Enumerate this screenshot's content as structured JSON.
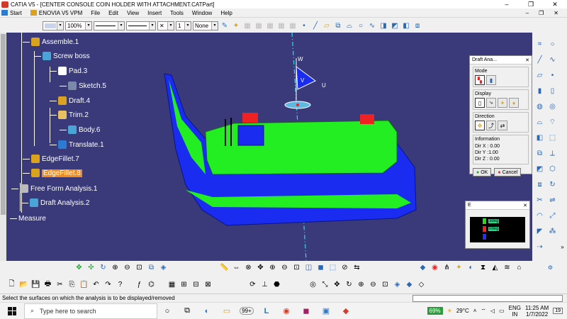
{
  "window": {
    "title": "CATIA V5 - [CENTER CONSOLE COIN HOLDER WITH ATTACHMENT.CATPart]",
    "minimize": "–",
    "restore": "❐",
    "close": "✕"
  },
  "menu": {
    "start": "Start",
    "enovia": "ENOVIA V5 VPM",
    "items": [
      "File",
      "Edit",
      "View",
      "Insert",
      "Tools",
      "Window",
      "Help"
    ],
    "doc_minimize": "–",
    "doc_restore": "❐",
    "doc_close": "✕"
  },
  "toolbar": {
    "zoom_value": "100%",
    "layer_value": "None",
    "point_value": "1"
  },
  "tree": {
    "items": [
      {
        "label": "Assemble.1",
        "icon": "assemble-icon"
      },
      {
        "label": "Screw boss",
        "icon": "body-icon"
      },
      {
        "label": "Pad.3",
        "icon": "pad-icon"
      },
      {
        "label": "Sketch.5",
        "icon": "sketch-icon"
      },
      {
        "label": "Draft.4",
        "icon": "draft-icon"
      },
      {
        "label": "Trim.2",
        "icon": "trim-icon"
      },
      {
        "label": "Body.6",
        "icon": "body-icon"
      },
      {
        "label": "Translate.1",
        "icon": "translate-icon"
      },
      {
        "label": "EdgeFillet.7",
        "icon": "fillet-icon"
      },
      {
        "label": "EdgeFillet.8",
        "icon": "fillet-icon"
      },
      {
        "label": "Free Form Analysis.1",
        "icon": "analysis-set-icon"
      },
      {
        "label": "Draft Analysis.2",
        "icon": "draft-analysis-icon"
      },
      {
        "label": "Measure",
        "icon": "measure-icon"
      }
    ]
  },
  "compass": {
    "w": "W",
    "v": "V",
    "u": "U"
  },
  "draft_dialog": {
    "title": "Draft Ana...",
    "close": "✕",
    "mode_label": "Mode",
    "display_label": "Display",
    "direction_label": "Direction",
    "information_label": "Information",
    "dir_x": "Dir X : 0.00",
    "dir_y": "Dir Y :1.00",
    "dir_z": "Dir Z : 0.00",
    "ok": "OK",
    "cancel": "Cancel"
  },
  "legend_window": {
    "title": "E",
    "close": "✕",
    "entries": [
      {
        "color": "#22dd22",
        "label": "3deg"
      },
      {
        "color": "#ee2222",
        "label": "0deg"
      },
      {
        "color": "#2233ee",
        "label": ""
      }
    ]
  },
  "status": {
    "message": "Select the surfaces on which the analysis is to be displayed/removed"
  },
  "taskbar": {
    "search_placeholder": "Type here to search",
    "badge": "99+",
    "battery": "69%",
    "temperature": "29°C",
    "lang1": "ENG",
    "lang2": "IN",
    "time": "11:25 AM",
    "date": "1/7/2022",
    "notifications": "19"
  },
  "colors": {
    "background": "#3a3a7a",
    "green_surface": "#22ee22",
    "blue_surface": "#1a2cf0",
    "red_surface": "#ee2222",
    "highlight": "#f18c1a"
  }
}
